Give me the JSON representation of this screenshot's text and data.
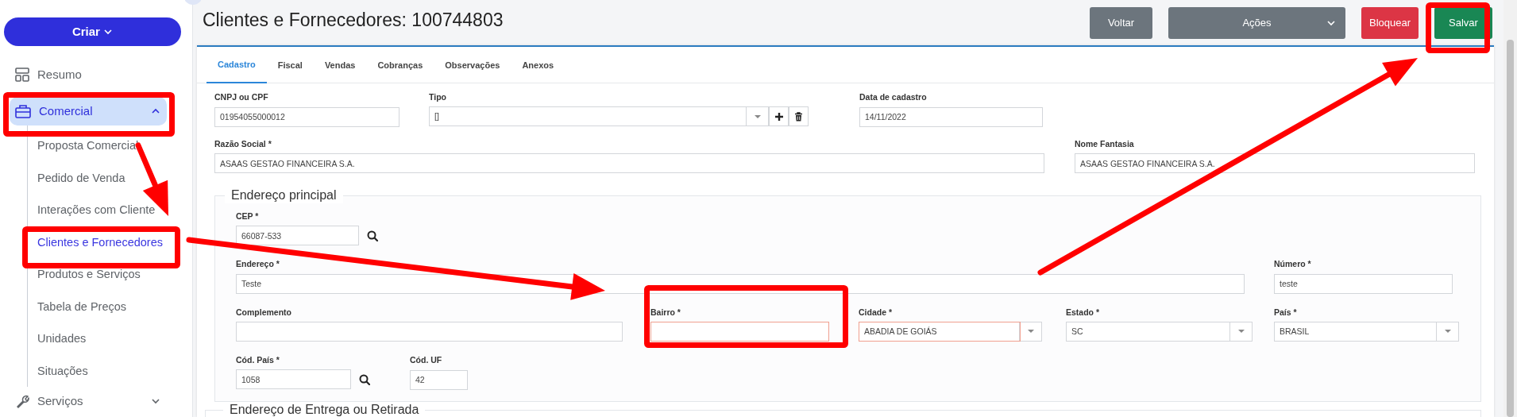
{
  "sidebar": {
    "create_button": "Criar",
    "items": [
      {
        "label": "Resumo",
        "selected": false
      },
      {
        "label": "Comercial",
        "selected": true,
        "expanded": true,
        "children": [
          {
            "label": "Proposta Comercial",
            "selected": false
          },
          {
            "label": "Pedido de Venda",
            "selected": false
          },
          {
            "label": "Interações com Cliente",
            "selected": false
          },
          {
            "label": "Clientes e Fornecedores",
            "selected": true
          },
          {
            "label": "Produtos e Serviços",
            "selected": false
          },
          {
            "label": "Tabela de Preços",
            "selected": false
          },
          {
            "label": "Unidades",
            "selected": false
          },
          {
            "label": "Situações",
            "selected": false
          }
        ]
      },
      {
        "label": "Serviços",
        "selected": false,
        "expanded": false
      }
    ]
  },
  "page": {
    "title": "Clientes e Fornecedores: 100744803",
    "buttons": [
      {
        "label": "Voltar",
        "kind": "secondary"
      },
      {
        "label": "Ações",
        "kind": "dropdown"
      },
      {
        "label": "Bloquear",
        "kind": "danger"
      },
      {
        "label": "Salvar",
        "kind": "success"
      }
    ]
  },
  "tabs": [
    {
      "label": "Cadastro",
      "selected": true
    },
    {
      "label": "Fiscal",
      "selected": false
    },
    {
      "label": "Vendas",
      "selected": false
    },
    {
      "label": "Cobranças",
      "selected": false
    },
    {
      "label": "Observações",
      "selected": false
    },
    {
      "label": "Anexos",
      "selected": false
    }
  ],
  "rows": [
    [
      {
        "label": "CNPJ ou CPF",
        "value": "01954055000012",
        "kind": "text",
        "invalid": false
      },
      {
        "label": "Tipo",
        "value": "[]",
        "kind": "select_tools",
        "invalid": false
      },
      {
        "label": "Data de cadastro",
        "value": "14/11/2022",
        "kind": "text",
        "invalid": false
      }
    ],
    [
      {
        "label": "Razão Social *",
        "value": "ASAAS GESTAO FINANCEIRA S.A.",
        "kind": "text",
        "invalid": false
      },
      {
        "label": "Nome Fantasia",
        "value": "ASAAS GESTAO FINANCEIRA S.A.",
        "kind": "text",
        "invalid": false
      }
    ]
  ],
  "sections": [
    {
      "title": "Endereço principal",
      "groups": [
        {
          "fields": [
            {
              "label": "CEP *",
              "value": "66087-533",
              "kind": "text_search",
              "invalid": false
            }
          ]
        },
        {
          "fields": [
            {
              "label": "Endereço *",
              "value": "Teste",
              "kind": "text",
              "invalid": false
            },
            {
              "label": "Número *",
              "value": "teste",
              "kind": "text",
              "invalid": false
            }
          ]
        },
        {
          "fields": [
            {
              "label": "Complemento",
              "kind": "text",
              "invalid": false
            },
            {
              "label": "Bairro *",
              "kind": "text",
              "invalid": true
            },
            {
              "label": "Cidade *",
              "value": "ABADIA DE GOIÁS",
              "kind": "select",
              "invalid": true
            },
            {
              "label": "Estado *",
              "value": "SC",
              "kind": "select",
              "invalid": false
            },
            {
              "label": "País *",
              "value": "BRASIL",
              "kind": "select",
              "invalid": false
            }
          ]
        },
        {
          "fields": [
            {
              "label": "Cód. País *",
              "value": "1058",
              "kind": "text_search",
              "invalid": false
            },
            {
              "label": "Cód. UF",
              "value": "42",
              "kind": "text",
              "invalid": false
            }
          ]
        }
      ]
    },
    {
      "title": "Endereço de Entrega ou Retirada"
    }
  ]
}
